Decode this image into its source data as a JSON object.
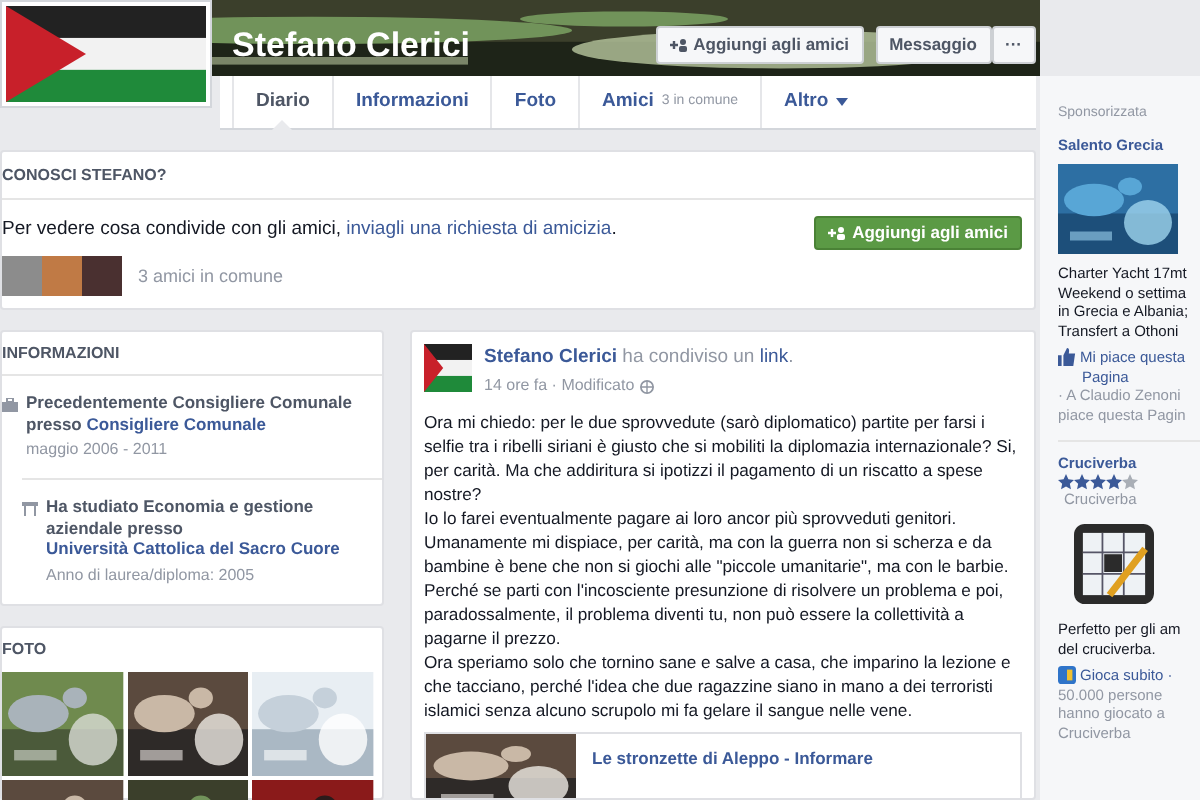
{
  "profile": {
    "name": "Stefano Clerici"
  },
  "header_buttons": [
    {
      "label": "Aggiungi agli amici",
      "kind": "add"
    },
    {
      "label": "Messaggio",
      "kind": "plain"
    },
    {
      "label": "···",
      "kind": "plain"
    }
  ],
  "tabs": [
    {
      "label": "Diario",
      "selected": true
    },
    {
      "label": "Informazioni",
      "selected": false
    },
    {
      "label": "Foto",
      "selected": false
    },
    {
      "label": "Amici",
      "selected": false,
      "note": "3 in comune"
    },
    {
      "label": "Altro",
      "selected": false,
      "dropdown": true
    }
  ],
  "know_card": {
    "title": "CONOSCI STEFANO?",
    "text": "Per vedere cosa condivide con gli amici, ",
    "link": "inviagli una richiesta di amicizia",
    "end": ".",
    "button": "Aggiungi agli amici",
    "mutual": "3 amici in comune"
  },
  "info": {
    "title": "INFORMAZIONI",
    "items": [
      {
        "kind": "work",
        "text": "Precedentemente Consigliere Comunale presso ",
        "link": "Consigliere Comunale",
        "sub": "maggio 2006 - 2011"
      },
      {
        "kind": "school",
        "text": "Ha studiato Economia e gestione aziendale presso ",
        "link": "Università Cattolica del Sacro Cuore",
        "sub": "Anno di laurea/diploma: 2005"
      }
    ]
  },
  "photos": {
    "title": "FOTO"
  },
  "post": {
    "author": "Stefano Clerici",
    "action": " ha condiviso un ",
    "object": "link",
    "end": ".",
    "time": "14 ore fa · Modificato",
    "paragraphs": [
      "Ora mi chiedo: per le due sprovvedute (sarò diplomatico) partite per farsi i selfie tra i ribelli siriani è giusto che si mobiliti la diplomazia internazionale? Si, per carità. Ma che addiritura si ipotizzi il pagamento di un riscatto a spese nostre?",
      "Io lo farei eventualmente pagare ai loro ancor più sprovveduti genitori.",
      "Umanamente mi dispiace, per carità, ma con la guerra non si scherza e da bambine è bene che non si giochi alle \"piccole umanitarie\", ma con le barbie.",
      "Perché se parti con l'incosciente presunzione di risolvere un problema e poi, paradossalmente, il problema diventi tu, non può essere la collettività a pagarne il prezzo.",
      "Ora speriamo solo che tornino sane e salve a casa, che imparino la lezione e che tacciano, perché l'idea che due ragazzine siano in mano a dei terroristi islamici senza alcuno scrupolo mi fa gelare il sangue nelle vene."
    ],
    "link_title": "Le stronzette di Aleppo - Informare"
  },
  "sidebar": {
    "label": "Sponsorizzata",
    "ads": [
      {
        "title": "Salento Grecia",
        "lines": [
          "Charter Yacht 17mt",
          "Weekend o settima",
          "in Grecia e Albania;",
          "Transfert a Othoni"
        ],
        "action": "Mi piace questa",
        "action_2": "Pagina",
        "social": [
          "· A Claudio Zenoni",
          "piace questa Pagin"
        ]
      },
      {
        "title": "Cruciverba",
        "kind": "app",
        "stars": 4,
        "subtitle": "Cruciverba",
        "lines": [
          "Perfetto per gli am",
          "del cruciverba."
        ],
        "action": "Gioca subito ·",
        "social": [
          "50.000 persone",
          "hanno giocato a",
          "Cruciverba"
        ]
      }
    ]
  }
}
